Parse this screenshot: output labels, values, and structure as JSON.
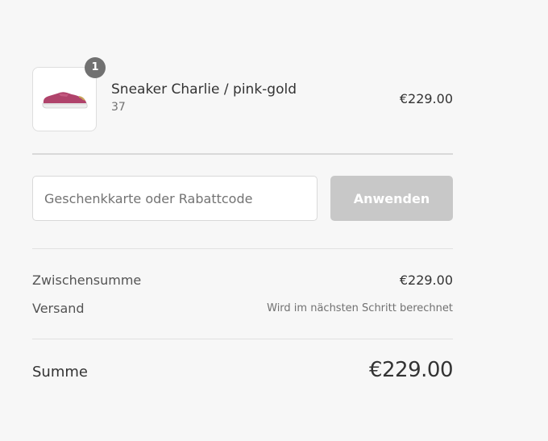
{
  "product": {
    "quantity": "1",
    "name": "Sneaker Charlie / pink-gold",
    "variant": "37",
    "price": "€229.00",
    "image_icon": "sneaker-thumbnail",
    "shoe_color": "#b0436b"
  },
  "discount": {
    "placeholder": "Geschenkkarte oder Rabattcode",
    "value": "",
    "apply_label": "Anwenden"
  },
  "totals": {
    "subtotal_label": "Zwischensumme",
    "subtotal_value": "€229.00",
    "shipping_label": "Versand",
    "shipping_value": "Wird im nächsten Schritt berechnet",
    "total_label": "Summe",
    "total_value": "€229.00"
  }
}
